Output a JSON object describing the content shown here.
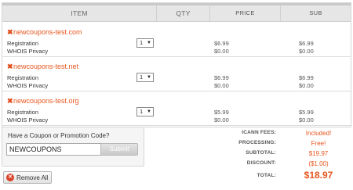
{
  "header": {
    "item": "ITEM",
    "qty": "QTY",
    "price": "PRICE",
    "sub": "SUB"
  },
  "items": [
    {
      "domain": "newcoupons-test.com",
      "qty": "1",
      "lines": [
        {
          "label": "Registration",
          "price": "$6.99",
          "sub": "$6.99"
        },
        {
          "label": "WHOIS Privacy",
          "price": "$0.00",
          "sub": "$0.00"
        }
      ]
    },
    {
      "domain": "newcoupons-test.net",
      "qty": "1",
      "lines": [
        {
          "label": "Registration",
          "price": "$6.99",
          "sub": "$6.99"
        },
        {
          "label": "WHOIS Privacy",
          "price": "$0.00",
          "sub": "$0.00"
        }
      ]
    },
    {
      "domain": "newcoupons-test.org",
      "qty": "1",
      "lines": [
        {
          "label": "Registration",
          "price": "$5.99",
          "sub": "$5.99"
        },
        {
          "label": "WHOIS Privacy",
          "price": "$0.00",
          "sub": "$0.00"
        }
      ]
    }
  ],
  "coupon": {
    "label": "Have a Coupon or Promotion Code?",
    "value": "NEWCOUPONS",
    "submit_label": "Submit"
  },
  "remove_all_label": "Remove All",
  "totals": [
    {
      "label": "ICANN FEES:",
      "value": "Included!"
    },
    {
      "label": "PROCESSING:",
      "value": "Free!"
    },
    {
      "label": "SUBTOTAL:",
      "value": "$19.97"
    },
    {
      "label": "DISCOUNT:",
      "value": "($1.00)"
    },
    {
      "label": "TOTAL:",
      "value": "$18.97"
    }
  ],
  "colors": {
    "accent": "#e8561f",
    "remove_icon": "#d9432a"
  },
  "icons": {
    "domain_remove": "close-x-icon",
    "remove_all": "remove-circle-icon",
    "qty_dropdown": "chevron-down-icon"
  }
}
